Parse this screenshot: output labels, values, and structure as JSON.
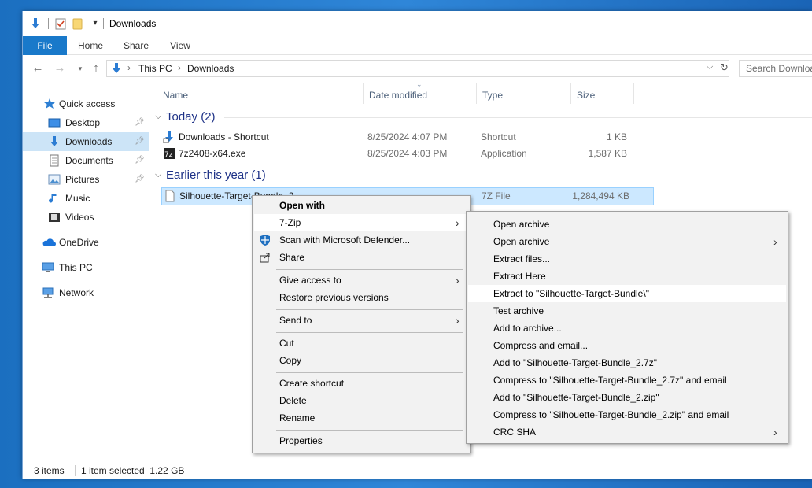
{
  "window": {
    "title": "Downloads"
  },
  "ribbon": {
    "tabs": [
      "File",
      "Home",
      "Share",
      "View"
    ]
  },
  "address": {
    "path": [
      "This PC",
      "Downloads"
    ],
    "search_placeholder": "Search Downloads"
  },
  "nav": {
    "items": [
      {
        "label": "Quick access",
        "icon": "star-icon"
      },
      {
        "label": "Desktop",
        "icon": "desktop-icon",
        "pinned": true
      },
      {
        "label": "Downloads",
        "icon": "download-icon",
        "pinned": true,
        "selected": true
      },
      {
        "label": "Documents",
        "icon": "documents-icon",
        "pinned": true
      },
      {
        "label": "Pictures",
        "icon": "pictures-icon",
        "pinned": true
      },
      {
        "label": "Music",
        "icon": "music-icon"
      },
      {
        "label": "Videos",
        "icon": "videos-icon"
      },
      {
        "label": "OneDrive",
        "icon": "cloud-icon"
      },
      {
        "label": "This PC",
        "icon": "computer-icon"
      },
      {
        "label": "Network",
        "icon": "network-icon"
      }
    ]
  },
  "columns": {
    "name": "Name",
    "date": "Date modified",
    "type": "Type",
    "size": "Size"
  },
  "groups": [
    {
      "title": "Today (2)",
      "files": [
        {
          "name": "Downloads - Shortcut",
          "date": "8/25/2024 4:07 PM",
          "type": "Shortcut",
          "size": "1 KB"
        },
        {
          "name": "7z2408-x64.exe",
          "date": "8/25/2024 4:03 PM",
          "type": "Application",
          "size": "1,587 KB"
        }
      ]
    },
    {
      "title": "Earlier this year (1)",
      "files": [
        {
          "name": "Silhouette-Target-Bundle_2",
          "date": "",
          "type": "7Z File",
          "size": "1,284,494 KB",
          "selected": true
        }
      ]
    }
  ],
  "status": {
    "items": "3 items",
    "selection": "1 item selected  1.22 GB"
  },
  "context_menu": {
    "items": [
      "Open with",
      "7-Zip",
      "Scan with Microsoft Defender...",
      "Share",
      "Give access to",
      "Restore previous versions",
      "Send to",
      "Cut",
      "Copy",
      "Create shortcut",
      "Delete",
      "Rename",
      "Properties"
    ]
  },
  "zip_menu": {
    "items": [
      "Open archive",
      "Open archive",
      "Extract files...",
      "Extract Here",
      "Extract to \"Silhouette-Target-Bundle\\\"",
      "Test archive",
      "Add to archive...",
      "Compress and email...",
      "Add to \"Silhouette-Target-Bundle_2.7z\"",
      "Compress to \"Silhouette-Target-Bundle_2.7z\" and email",
      "Add to \"Silhouette-Target-Bundle_2.zip\"",
      "Compress to \"Silhouette-Target-Bundle_2.zip\" and email",
      "CRC SHA"
    ]
  },
  "colors": {
    "accent": "#1979ca",
    "selection": "#cce8ff",
    "nav_selected": "#cce4f7",
    "group_header": "#1e3287"
  }
}
